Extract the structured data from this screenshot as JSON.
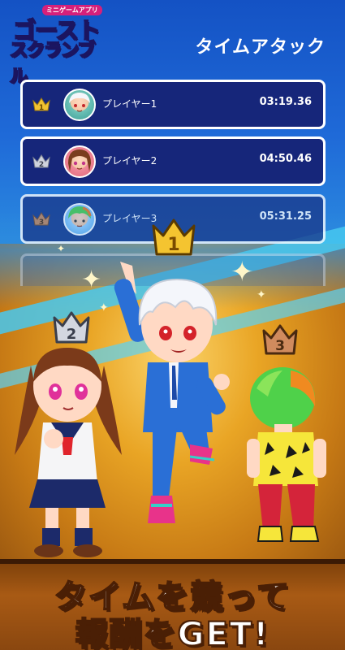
{
  "logo": {
    "small_text": "ミニゲームアプリ",
    "line1": "ゴースト",
    "line2": "スクランブル"
  },
  "header": {
    "title": "タイムアタック"
  },
  "ranking": [
    {
      "rank": "1",
      "name": "プレイヤー1",
      "time": "03:19.36",
      "crown_color": "#f1c232"
    },
    {
      "rank": "2",
      "name": "プレイヤー2",
      "time": "04:50.46",
      "crown_color": "#cfd3dc"
    },
    {
      "rank": "3",
      "name": "プレイヤー3",
      "time": "05:31.25",
      "crown_color": "#c7865a"
    }
  ],
  "podium_crowns": {
    "first": "1",
    "second": "2",
    "third": "3"
  },
  "caption": {
    "line1": "タイムを競って",
    "line2": "報酬をGET!"
  },
  "colors": {
    "background_blue": "#1452c4",
    "stage_gold": "#e9a525",
    "row_bg": "#16267a",
    "crown_gold": "#f1c232",
    "crown_silver": "#cfd3dc",
    "crown_bronze": "#c7865a"
  }
}
